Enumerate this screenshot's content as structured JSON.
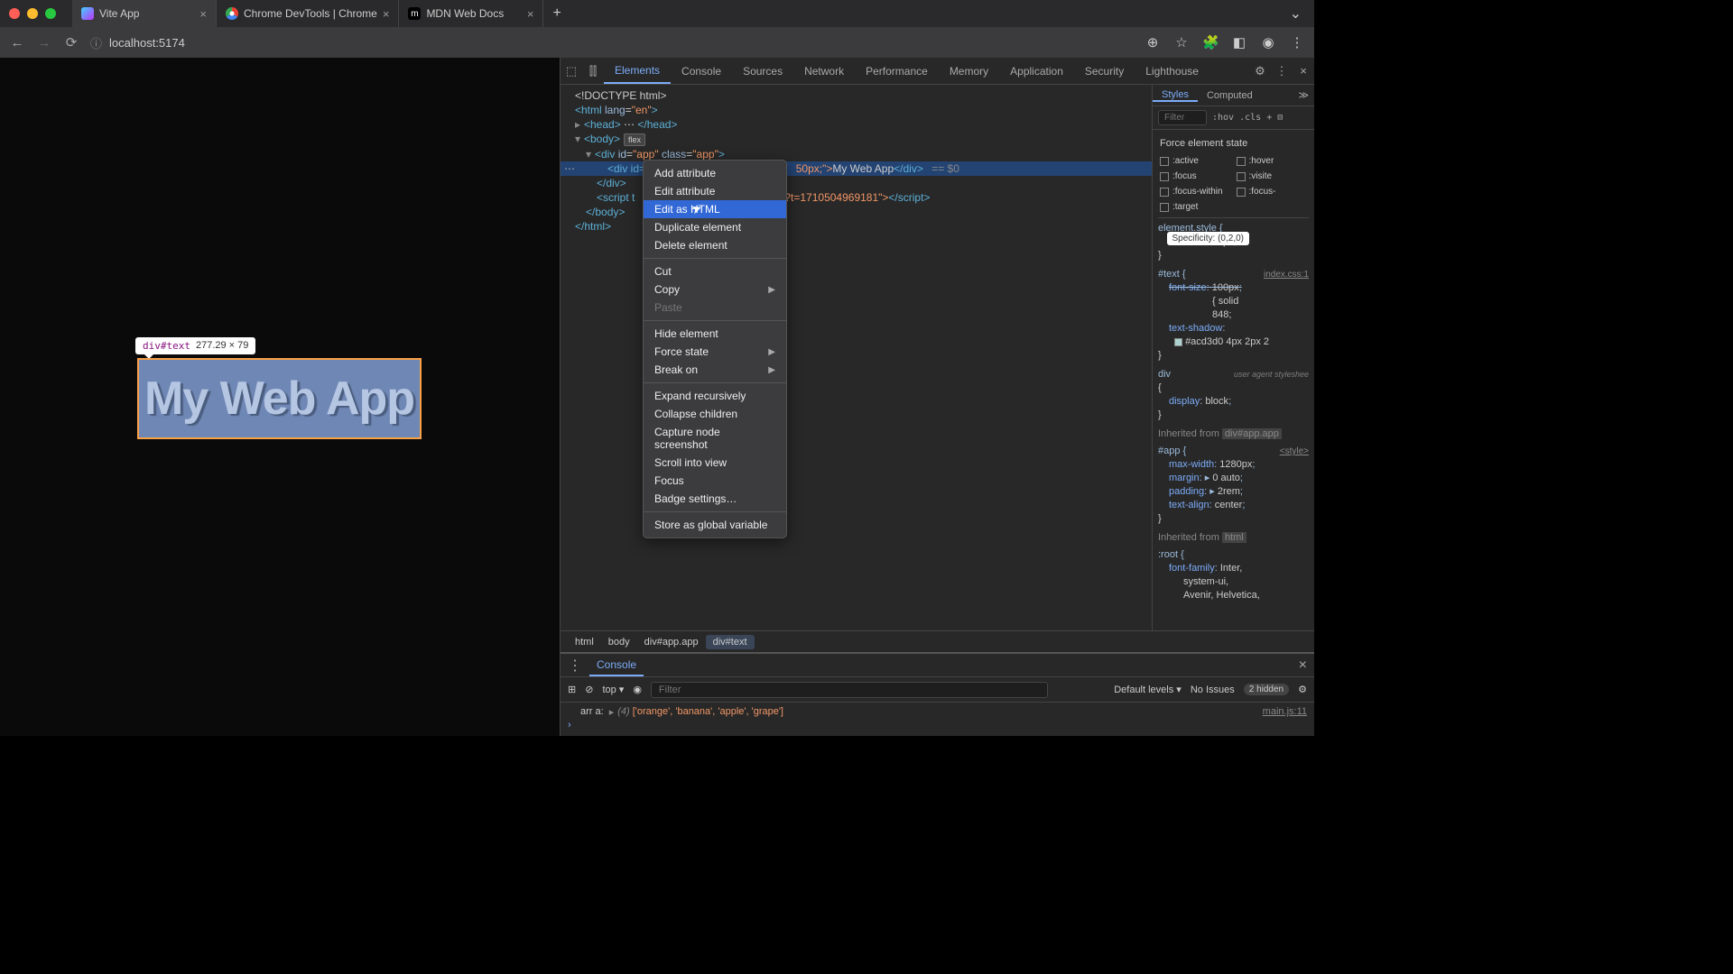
{
  "tabs": [
    {
      "title": "Vite App",
      "active": true
    },
    {
      "title": "Chrome DevTools | Chrome",
      "active": false
    },
    {
      "title": "MDN Web Docs",
      "active": false
    }
  ],
  "url": "localhost:5174",
  "page": {
    "text": "My Web App",
    "inspect_selector": "div#text",
    "inspect_dims": "277.29 × 79"
  },
  "devtools_tabs": [
    "Elements",
    "Console",
    "Sources",
    "Network",
    "Performance",
    "Memory",
    "Application",
    "Security",
    "Lighthouse"
  ],
  "devtools_active": "Elements",
  "dom": {
    "doctype": "<!DOCTYPE html>",
    "html_attr": "lang=\"en\"",
    "head": "<head>…</head>",
    "body_badge": "flex",
    "app_line_id": "app",
    "app_line_class": "app",
    "sel_left": "<div id=",
    "sel_right": "50px;\">",
    "sel_text": "My Web App",
    "sel_close": "</div>",
    "sel_eq": "== $0",
    "script_left": "<script t",
    "script_right": "s?t=1710504969181\">",
    "script_close": "</script>"
  },
  "context_menu": {
    "items": [
      {
        "label": "Add attribute"
      },
      {
        "label": "Edit attribute"
      },
      {
        "label": "Edit as HTML",
        "highlighted": true
      },
      {
        "label": "Duplicate element"
      },
      {
        "label": "Delete element"
      },
      {
        "sep": true
      },
      {
        "label": "Cut"
      },
      {
        "label": "Copy",
        "sub": true
      },
      {
        "label": "Paste",
        "disabled": true
      },
      {
        "sep": true
      },
      {
        "label": "Hide element"
      },
      {
        "label": "Force state",
        "sub": true
      },
      {
        "label": "Break on",
        "sub": true
      },
      {
        "sep": true
      },
      {
        "label": "Expand recursively"
      },
      {
        "label": "Collapse children"
      },
      {
        "label": "Capture node screenshot"
      },
      {
        "label": "Scroll into view"
      },
      {
        "label": "Focus"
      },
      {
        "label": "Badge settings…"
      },
      {
        "sep": true
      },
      {
        "label": "Store as global variable"
      }
    ]
  },
  "styles": {
    "tabs": [
      "Styles",
      "Computed"
    ],
    "filter_placeholder": "Filter",
    "hov": ":hov",
    "cls": ".cls",
    "force_label": "Force element state",
    "states": [
      ":active",
      ":hover",
      ":focus",
      ":visite",
      ":focus-within",
      ":focus-",
      ":target"
    ],
    "rules": {
      "elstyle": "element.style {",
      "elstyle_prop": "font-size: 50px;",
      "text_sel": "#text {",
      "text_src": "index.css:1",
      "text_prop1": "font-size: 100px;",
      "text_prop2": "{ solid",
      "text_prop3": "848;",
      "text_prop4": "text-shadow:",
      "text_color": "#acd3d0 4px 2px 2",
      "specificity": "Specificity: (0,2,0)",
      "div_sel": "div",
      "div_src": "user agent styleshee",
      "div_prop": "display: block;",
      "inh_app": "Inherited from",
      "inh_app_el": "div#app.app",
      "app_sel": "#app {",
      "app_src": "<style>",
      "app_p1": "max-width: 1280px;",
      "app_p2": "margin: ▸ 0 auto;",
      "app_p3": "padding: ▸ 2rem;",
      "app_p4": "text-align: center;",
      "inh_html": "Inherited from",
      "inh_html_el": "html",
      "root_sel": ":root {",
      "root_p1": "font-family: Inter,",
      "root_p2": "system-ui,",
      "root_p3": "Avenir, Helvetica,"
    }
  },
  "breadcrumb": [
    "html",
    "body",
    "div#app.app",
    "div#text"
  ],
  "console": {
    "tab": "Console",
    "context": "top",
    "filter_placeholder": "Filter",
    "levels": "Default levels",
    "issues": "No Issues",
    "hidden": "2 hidden",
    "log_label": "arr a:",
    "log_len": "(4)",
    "log_arr": "['orange', 'banana', 'apple', 'grape']",
    "log_src": "main.js:11"
  }
}
